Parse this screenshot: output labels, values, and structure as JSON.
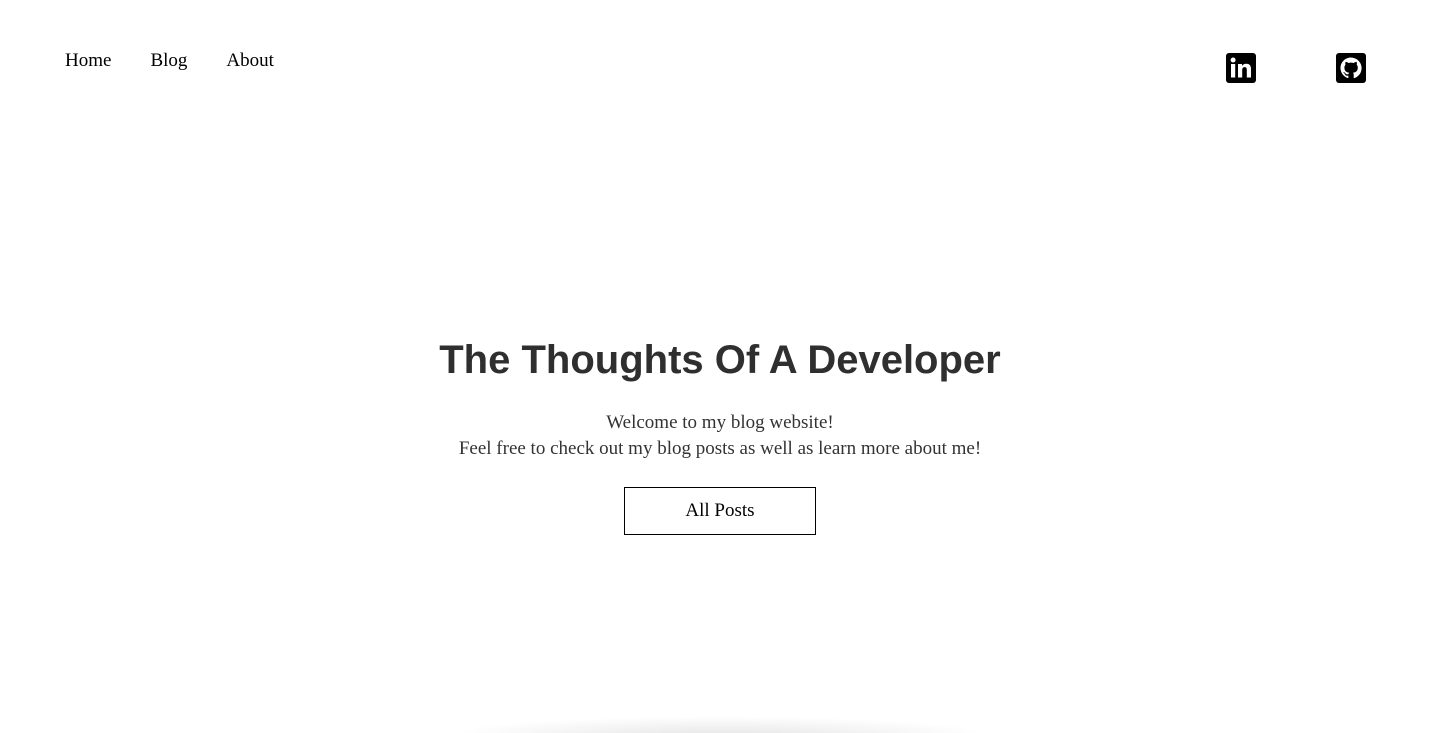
{
  "nav": {
    "items": [
      {
        "label": "Home"
      },
      {
        "label": "Blog"
      },
      {
        "label": "About"
      }
    ]
  },
  "social": {
    "linkedin_icon": "linkedin-icon",
    "github_icon": "github-icon"
  },
  "hero": {
    "title": "The Thoughts Of A Developer",
    "intro_line1": "Welcome to my blog website!",
    "intro_line2": "Feel free to check out my blog posts as well as learn more about me!",
    "button_label": "All Posts"
  },
  "colors": {
    "background": "#ffffff",
    "title": "#2f2f2f",
    "text": "#333333",
    "icon": "#000000"
  }
}
